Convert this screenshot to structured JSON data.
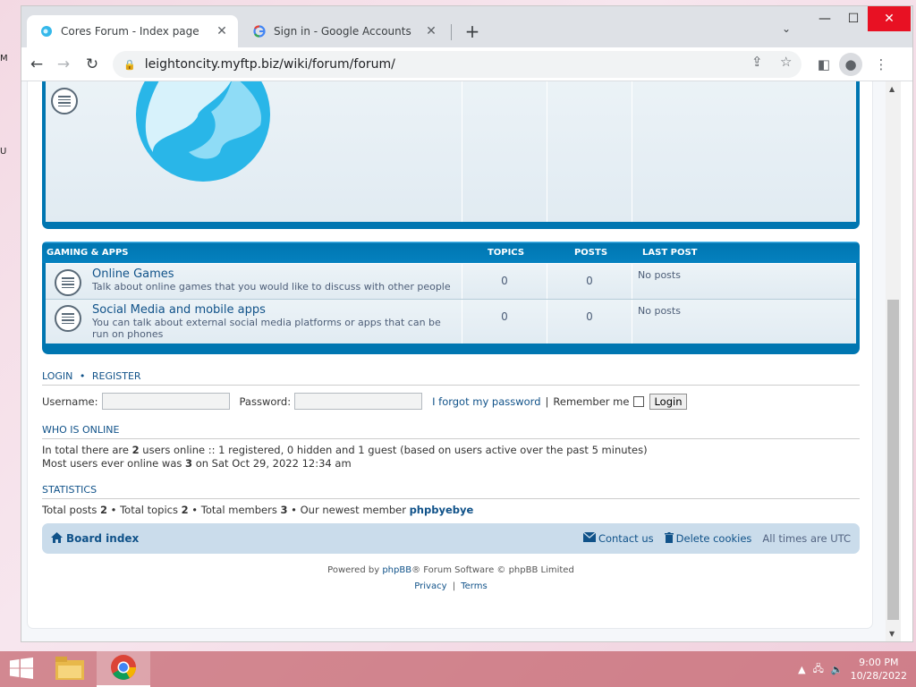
{
  "browser": {
    "tabs": [
      {
        "title": "Cores Forum - Index page",
        "favicon": "forum-globe-icon",
        "active": true
      },
      {
        "title": "Sign in - Google Accounts",
        "favicon": "google-g-icon",
        "active": false
      }
    ],
    "url": "leightoncity.myftp.biz/wiki/forum/forum/"
  },
  "forum": {
    "gaming": {
      "header": {
        "name": "GAMING & APPS",
        "topics": "TOPICS",
        "posts": "POSTS",
        "last_post": "LAST POST"
      },
      "forums": [
        {
          "name": "Online Games",
          "desc": "Talk about online games that you would like to discuss with other people",
          "topics": "0",
          "posts": "0",
          "last": "No posts"
        },
        {
          "name": "Social Media and mobile apps",
          "desc": "You can talk about external social media platforms or apps that can be run on phones",
          "topics": "0",
          "posts": "0",
          "last": "No posts"
        }
      ]
    },
    "login": {
      "title_login": "LOGIN",
      "sep": "•",
      "title_register": "REGISTER",
      "username_label": "Username:",
      "password_label": "Password:",
      "forgot": "I forgot my password",
      "pipe": "|",
      "remember": "Remember me",
      "button": "Login"
    },
    "online": {
      "title": "WHO IS ONLINE",
      "line1_a": "In total there are ",
      "line1_b": "2",
      "line1_c": " users online :: 1 registered, 0 hidden and 1 guest (based on users active over the past 5 minutes)",
      "line2_a": "Most users ever online was ",
      "line2_b": "3",
      "line2_c": " on Sat Oct 29, 2022 12:34 am"
    },
    "stats": {
      "title": "STATISTICS",
      "a": "Total posts ",
      "b": "2",
      "c": " • Total topics ",
      "d": "2",
      "e": " • Total members ",
      "f": "3",
      "g": " • Our newest member ",
      "newest": "phpbyebye"
    },
    "navbar": {
      "board_index": "Board index",
      "contact": "Contact us",
      "delete_cookies": "Delete cookies",
      "timezone": "All times are UTC"
    },
    "footer": {
      "powered_a": "Powered by ",
      "phpbb": "phpBB",
      "powered_b": "® Forum Software © phpBB Limited",
      "privacy": "Privacy",
      "pipe": "|",
      "terms": "Terms"
    }
  },
  "taskbar": {
    "time": "9:00 PM",
    "date": "10/28/2022"
  },
  "colors": {
    "header_blue": "#12a3eb",
    "border_blue": "#0076b1",
    "link": "#105289",
    "navbar_bg": "#cadceb"
  }
}
